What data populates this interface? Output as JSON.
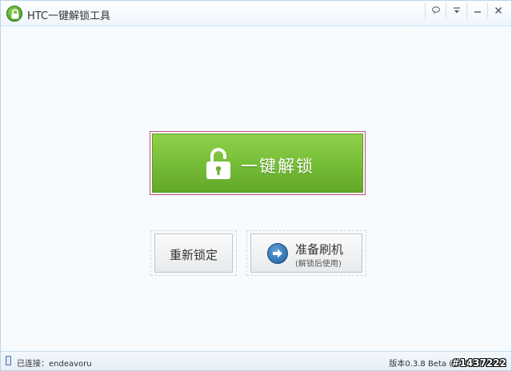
{
  "window": {
    "title": "HTC一键解锁工具",
    "buttons": [
      "feedback",
      "menu",
      "minimize",
      "close"
    ]
  },
  "main": {
    "unlock_label": "一键解锁",
    "relock_label": "重新锁定",
    "flash_label": "准备刷机",
    "flash_sub": "(解锁后使用)"
  },
  "status": {
    "connection": "已连接：endeavoru",
    "version": "版本0.3.8 Beta (已经是最新版)"
  },
  "watermark": "#1437222",
  "colors": {
    "unlock_green": "#79c03a",
    "focus_border": "#c64d7c",
    "arrow_blue": "#2a6fb0"
  }
}
